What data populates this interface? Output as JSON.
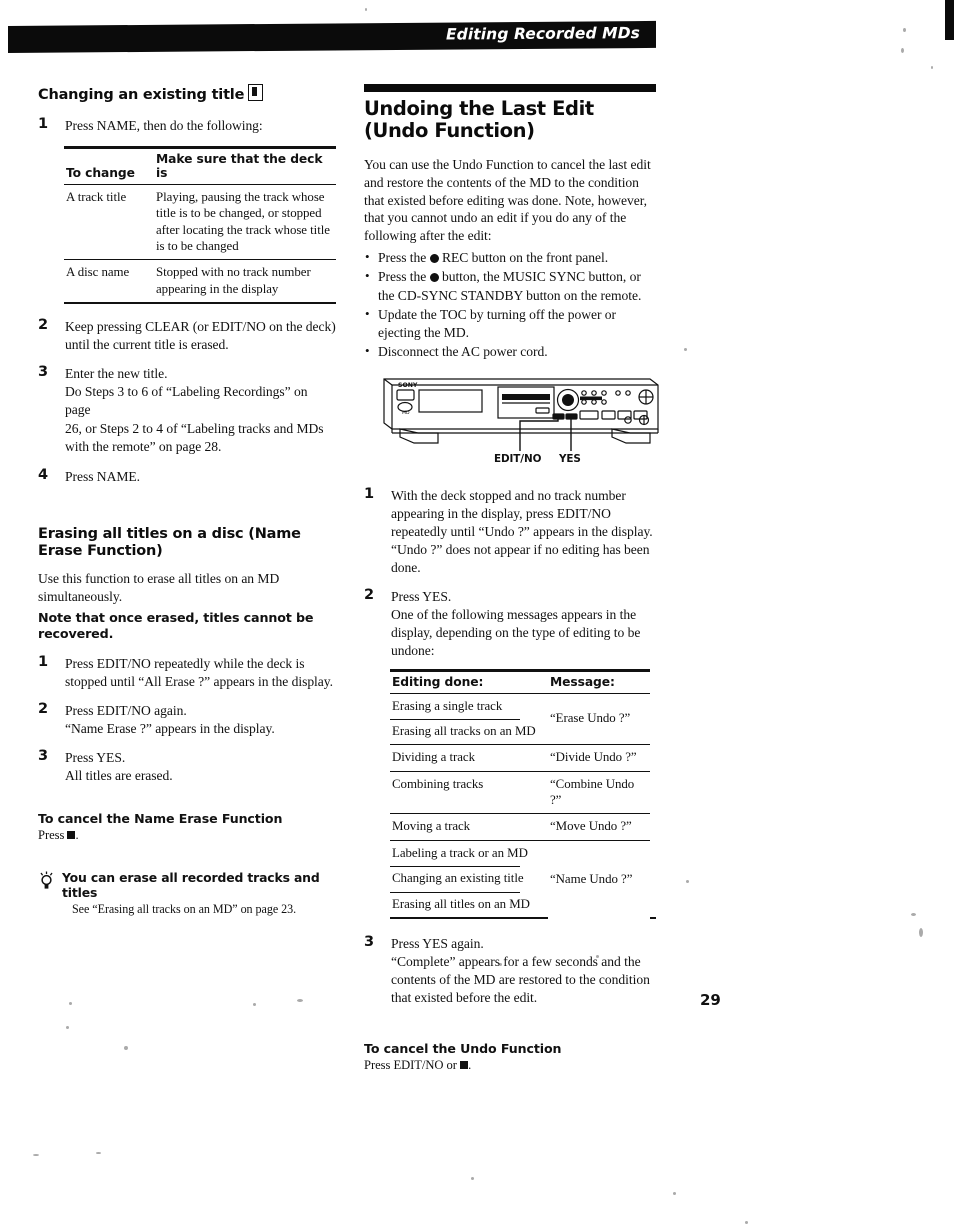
{
  "header": {
    "banner_title": "Editing Recorded MDs"
  },
  "page_number": "29",
  "left_column": {
    "section1": {
      "heading": "Changing an existing title",
      "heading_icon": "remote-control-icon",
      "step1": {
        "number": "1",
        "text": "Press NAME, then do the following:"
      },
      "table": {
        "headers": [
          "To change",
          "Make sure that the deck is"
        ],
        "rows": [
          {
            "to_change": "A track title",
            "condition": "Playing, pausing the track whose title is to be changed, or stopped after locating the track whose title is to be changed"
          },
          {
            "to_change": "A disc name",
            "condition": "Stopped with no track number appearing in the display"
          }
        ]
      },
      "step2": {
        "number": "2",
        "lines": [
          "Keep pressing CLEAR (or EDIT/NO on the deck)",
          "until the current title is erased."
        ]
      },
      "step3": {
        "number": "3",
        "lines": [
          "Enter the new title.",
          "Do Steps 3 to 6 of “Labeling Recordings” on page",
          "26, or Steps 2 to 4 of “Labeling tracks and MDs",
          "with the remote” on page 28."
        ]
      },
      "step4": {
        "number": "4",
        "lines": [
          "Press NAME."
        ]
      }
    },
    "section2": {
      "heading": "Erasing all titles on a disc (Name Erase Function)",
      "intro_lines": [
        "Use this function to erase all titles on an MD",
        "simultaneously."
      ],
      "note": "Note that once erased, titles cannot be recovered.",
      "step1": {
        "number": "1",
        "lines": [
          "Press EDIT/NO repeatedly while the deck is",
          "stopped until “All Erase ?” appears in the display."
        ]
      },
      "step2": {
        "number": "2",
        "lines": [
          "Press EDIT/NO again.",
          "“Name Erase ?” appears in the display."
        ]
      },
      "step3": {
        "number": "3",
        "lines": [
          "Press YES.",
          "All titles are erased."
        ]
      },
      "cancel": {
        "title": "To cancel the Name Erase Function",
        "press_prefix": "Press",
        "press_suffix": "."
      },
      "tip": {
        "icon": "lightbulb-tip-icon",
        "title": "You can erase all recorded tracks and titles",
        "body": "See “Erasing all tracks on an MD” on page 23."
      }
    }
  },
  "right_column": {
    "heading_line1": "Undoing the Last Edit",
    "heading_line2": "(Undo Function)",
    "intro_lines": [
      "You can use the Undo Function to cancel the last edit",
      "and restore the contents of the MD to the condition that",
      "existed before editing was done.  Note, however, that",
      "you cannot undo an edit if you do any of the following",
      "after the edit:"
    ],
    "bullets": [
      {
        "before": "Press the ",
        "icon": "rec-dot-icon",
        "after": " REC button on the front panel."
      },
      {
        "before": "Press the ",
        "icon": "rec-dot-icon",
        "after": " button, the MUSIC SYNC button, or the CD-SYNC STANDBY button on the remote."
      },
      {
        "before": "Update the TOC by turning off the power or ejecting the MD.",
        "icon": "",
        "after": ""
      },
      {
        "before": "Disconnect the AC power cord.",
        "icon": "",
        "after": ""
      }
    ],
    "illustration": {
      "brand": "SONY",
      "callouts": [
        "EDIT/NO",
        "YES"
      ]
    },
    "step1": {
      "number": "1",
      "lines": [
        "With the deck stopped and no track number",
        "appearing in the display, press EDIT/NO",
        "repeatedly until “Undo ?” appears in the display.",
        "“Undo ?” does not appear if no editing has been",
        "done."
      ]
    },
    "step2": {
      "number": "2",
      "lines": [
        "Press YES.",
        "One of the following messages appears in the",
        "display, depending on the type of editing to be",
        "undone:"
      ]
    },
    "table": {
      "headers": [
        "Editing done:",
        "Message:"
      ],
      "groups": [
        {
          "editing": [
            "Erasing a single track",
            "Erasing all tracks on an MD"
          ],
          "message": "“Erase Undo ?”"
        },
        {
          "editing": [
            "Dividing a track"
          ],
          "message": "“Divide Undo ?”"
        },
        {
          "editing": [
            "Combining tracks"
          ],
          "message": "“Combine Undo ?”"
        },
        {
          "editing": [
            "Moving a track"
          ],
          "message": "“Move Undo ?”"
        },
        {
          "editing": [
            "Labeling a track or an MD",
            "Changing an existing title",
            "Erasing all titles on an MD"
          ],
          "message": "“Name Undo ?”"
        }
      ]
    },
    "step3": {
      "number": "3",
      "lines": [
        "Press YES again.",
        "“Complete” appears for a few seconds and the",
        "contents of the MD are restored to the condition",
        "that existed before the edit."
      ]
    },
    "cancel": {
      "title": "To cancel the Undo Function",
      "press_prefix": "Press EDIT/NO or",
      "press_suffix": "."
    }
  }
}
